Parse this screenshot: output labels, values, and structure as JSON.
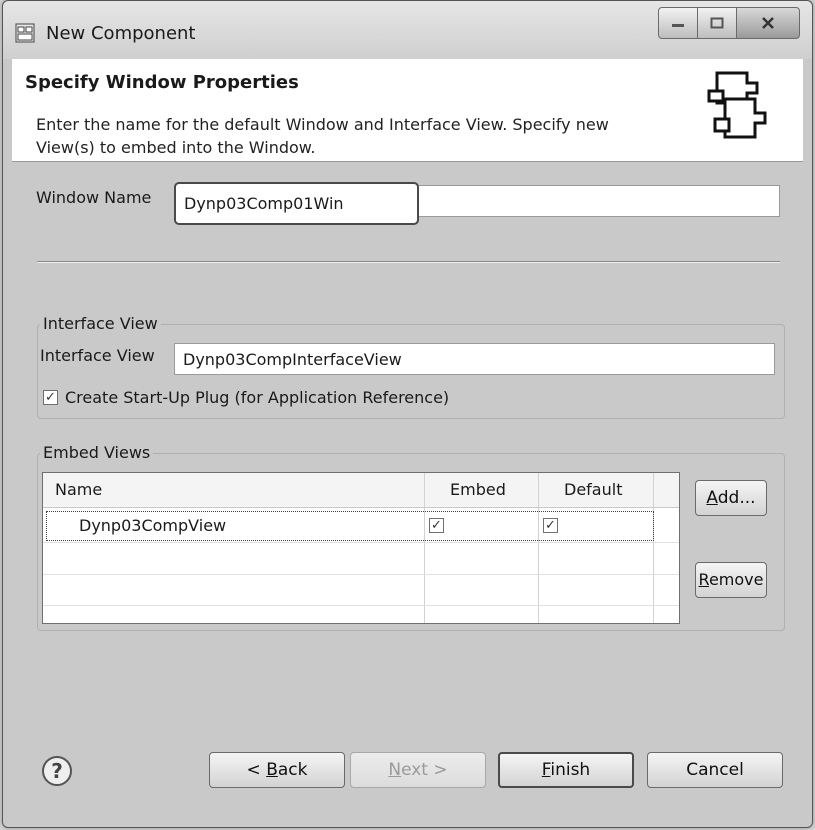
{
  "window": {
    "title": "New Component",
    "icon": "component-icon"
  },
  "header": {
    "title": "Specify Window Properties",
    "description": "Enter the name for the default Window and Interface View. Specify new View(s) to embed into the Window."
  },
  "form": {
    "window_name_label": "Window Name",
    "window_name_value": "Dynp03Comp01Win"
  },
  "interface_view_group": {
    "title": "Interface View",
    "label": "Interface View",
    "value": "Dynp03CompInterfaceView",
    "checkbox_label": "Create Start-Up Plug (for Application Reference)",
    "checkbox_checked": true
  },
  "embed_views_group": {
    "title": "Embed Views",
    "columns": [
      "Name",
      "Embed",
      "Default"
    ],
    "rows": [
      {
        "name": "Dynp03CompView",
        "embed": true,
        "default": true
      }
    ],
    "add_label_u": "A",
    "add_label_rest": "dd...",
    "remove_label_u": "R",
    "remove_label_rest": "emove"
  },
  "footer": {
    "back_pre": "< ",
    "back_u": "B",
    "back_rest": "ack",
    "next_u": "N",
    "next_rest": "ext >",
    "finish_u": "F",
    "finish_rest": "inish",
    "cancel_label": "Cancel"
  }
}
